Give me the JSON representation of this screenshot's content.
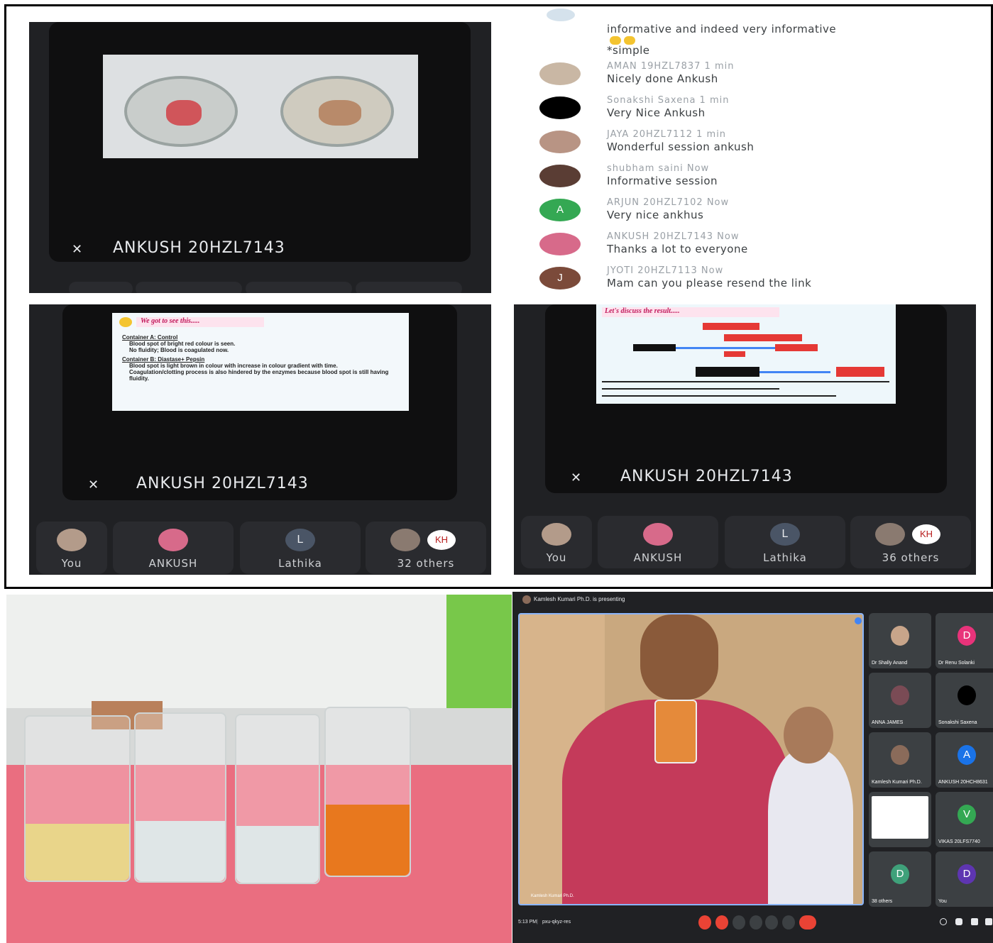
{
  "top_left": {
    "presenter_name": "ANKUSH 20HZL7143"
  },
  "chat": {
    "first_text": "informative and indeed very informative",
    "first_text_2": "*simple",
    "messages": [
      {
        "meta": "AMAN 19HZL7837  1 min",
        "text": "Nicely done Ankush",
        "avatar_color": "#c9b7a4",
        "avatar_letter": ""
      },
      {
        "meta": "Sonakshi Saxena  1 min",
        "text": "Very Nice Ankush",
        "avatar_color": "#000000",
        "avatar_letter": ""
      },
      {
        "meta": "JAYA 20HZL7112  1 min",
        "text": "Wonderful session ankush",
        "avatar_color": "#b89484",
        "avatar_letter": ""
      },
      {
        "meta": "shubham saini  Now",
        "text": "Informative session",
        "avatar_color": "#5a3d34",
        "avatar_letter": ""
      },
      {
        "meta": "ARJUN 20HZL7102  Now",
        "text": "Very nice ankhus",
        "avatar_color": "#34a853",
        "avatar_letter": "A"
      },
      {
        "meta": "ANKUSH 20HZL7143  Now",
        "text": "Thanks a lot to everyone",
        "avatar_color": "#d76a8a",
        "avatar_letter": ""
      },
      {
        "meta": "JYOTI 20HZL7113  Now",
        "text": "Mam can you please resend the link",
        "avatar_color": "#7b4a3a",
        "avatar_letter": "J"
      }
    ]
  },
  "bottom_left": {
    "slide_title": "We got to see this.....",
    "slide_lines": [
      "Container A: Control",
      "Blood spot of bright red colour is seen.",
      "No fluidity; Blood is coagulated now.",
      "Container B: Diastase+ Pepsin",
      "Blood spot is light brown in colour with increase in colour gradient with time.",
      "Coagulation/clotting process is also hindered by the enzymes because blood spot is still having fluidity."
    ],
    "presenter_name": "ANKUSH 20HZL7143",
    "participants": [
      {
        "label": "You"
      },
      {
        "label": "ANKUSH"
      },
      {
        "label": "Lathika",
        "letter": "L"
      },
      {
        "label": "32 others",
        "badge": "KH"
      }
    ]
  },
  "bottom_right": {
    "slide_title": "Let's discuss the result.....",
    "presenter_name": "ANKUSH 20HZL7143",
    "participants": [
      {
        "label": "You"
      },
      {
        "label": "ANKUSH"
      },
      {
        "label": "Lathika",
        "letter": "L"
      },
      {
        "label": "36 others",
        "badge": "KH"
      }
    ]
  },
  "meet": {
    "presenting_banner": "Kamlesh Kumari Ph.D. is presenting",
    "main_label": "Kamlesh Kumari Ph.D.",
    "time": "5:13 PM",
    "meeting_code": "pxu-qkyz-res",
    "tiles": [
      {
        "label": "Dr Shally Anand",
        "letter": "",
        "color": "#c8a58a"
      },
      {
        "label": "Dr Renu Solanki",
        "letter": "D",
        "color": "#e8337a"
      },
      {
        "label": "ANNA JAMES",
        "letter": "",
        "color": "#7a4b55"
      },
      {
        "label": "Sonakshi Saxena",
        "letter": "",
        "color": "#000000"
      },
      {
        "label": "Kamlesh Kumari Ph.D.",
        "letter": "",
        "color": "#8a6b5a"
      },
      {
        "label": "ANKUSH 20HCH8631",
        "letter": "A",
        "color": "#1a73e8"
      },
      {
        "label": "",
        "letter": "",
        "color": "#ffffff"
      },
      {
        "label": "VIKAS 20LFS7740",
        "letter": "V",
        "color": "#34a853"
      },
      {
        "label": "38 others",
        "letter": "D",
        "color": "#3fa17a"
      },
      {
        "label": "You",
        "letter": "D",
        "color": "#5e35b1"
      }
    ]
  }
}
